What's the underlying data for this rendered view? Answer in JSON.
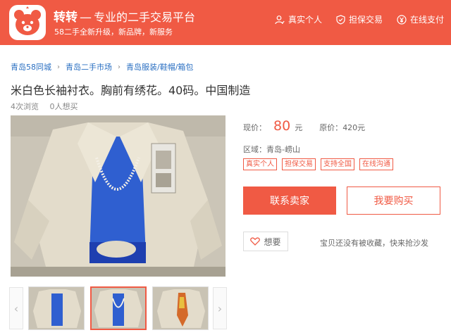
{
  "header": {
    "brand": "转转",
    "separator": "—",
    "slogan": "专业的二手交易平台",
    "subtitle": "58二手全新升级，新品牌，新服务",
    "features": [
      {
        "label": "真实个人",
        "icon": "person-verified-icon"
      },
      {
        "label": "担保交易",
        "icon": "shield-check-icon"
      },
      {
        "label": "在线支付",
        "icon": "yen-pay-icon"
      }
    ],
    "logo_icon": "zhuanzhuan-bear-logo"
  },
  "breadcrumb": [
    "青岛58同城",
    "青岛二手市场",
    "青岛服装/鞋帽/箱包"
  ],
  "product": {
    "title": "米白色长袖衬衣。胸前有绣花。40码。中国制造",
    "views": "4次浏览",
    "wants": "0人想买",
    "price_label": "现价：",
    "price": "80",
    "price_unit": "元",
    "original_label": "原价：",
    "original_price": "420元",
    "region_label": "区域：",
    "region": "青岛-崂山",
    "tags": [
      "真实个人",
      "担保交易",
      "支持全国",
      "在线沟通"
    ]
  },
  "actions": {
    "contact": "联系卖家",
    "buy": "我要购买",
    "want": "想要",
    "fav_note": "宝贝还没有被收藏，快来抢沙发"
  },
  "thumbnails": {
    "prev_icon": "chevron-left-icon",
    "next_icon": "chevron-right-icon",
    "count": 3,
    "selected_index": 1
  },
  "colors": {
    "brand": "#f05a44",
    "link": "#2a6fc2"
  }
}
